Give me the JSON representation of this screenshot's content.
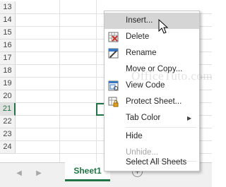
{
  "rows": [
    "13",
    "14",
    "15",
    "16",
    "17",
    "18",
    "19",
    "20",
    "21",
    "22",
    "23",
    "24"
  ],
  "active_row": "21",
  "menu": {
    "items": [
      {
        "id": "insert",
        "label": "Insert...",
        "icon": "",
        "hover": true
      },
      {
        "id": "delete",
        "label": "Delete",
        "icon": "delete-sheet-icon"
      },
      {
        "id": "rename",
        "label": "Rename",
        "icon": "rename-sheet-icon"
      },
      {
        "id": "move",
        "label": "Move or Copy...",
        "icon": ""
      },
      {
        "id": "view-code",
        "label": "View Code",
        "icon": "view-code-icon"
      },
      {
        "id": "protect",
        "label": "Protect Sheet...",
        "icon": "protect-sheet-icon"
      },
      {
        "id": "tab-color",
        "label": "Tab Color",
        "icon": "",
        "submenu": true
      },
      {
        "id": "hide",
        "label": "Hide",
        "icon": ""
      },
      {
        "id": "unhide",
        "label": "Unhide...",
        "icon": "",
        "disabled": true
      },
      {
        "id": "select-all",
        "label": "Select All Sheets",
        "icon": ""
      }
    ]
  },
  "tabbar": {
    "sheet_label": "Sheet1",
    "add_sheet": "+",
    "nav_prev": "◀",
    "nav_next": "▶"
  },
  "watermark": "OfficeTuto.com",
  "colors": {
    "excel_green": "#217346",
    "menu_hover": "#d5d5d5",
    "disabled_text": "#a6a6a6"
  }
}
